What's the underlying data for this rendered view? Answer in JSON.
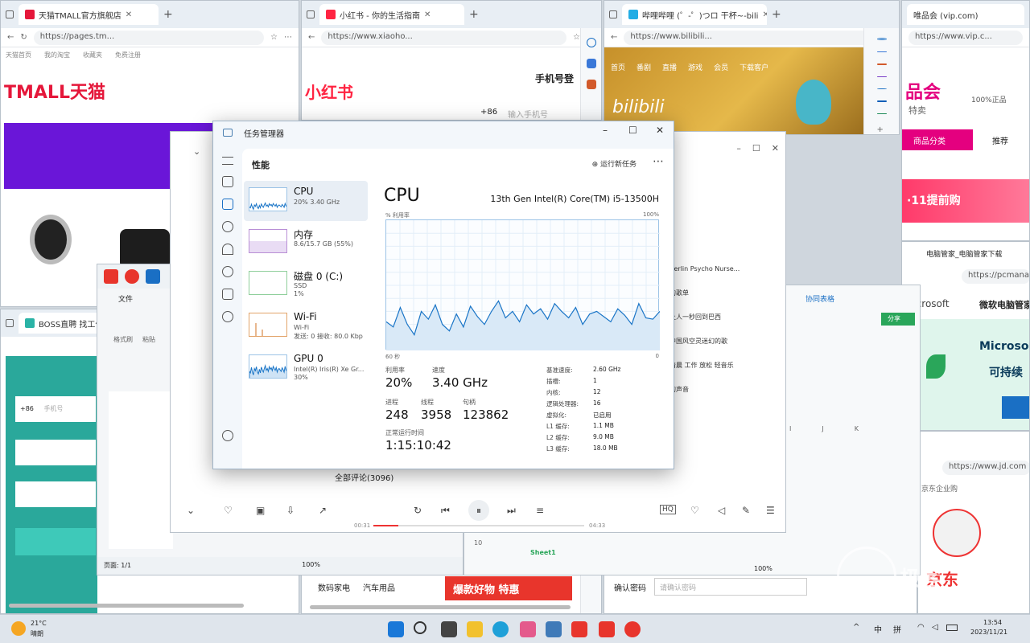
{
  "browsers": {
    "tmall": {
      "tab_title": "天猫TMALL官方旗舰店",
      "url": "https://pages.tm...",
      "logo": "TMALL天猫",
      "bookmarks": [
        "天猫首页",
        "我的淘宝",
        "收藏夹",
        "免费注册"
      ],
      "accent": "#e5173a"
    },
    "xiaohongshu": {
      "tab_title": "小红书 - 你的生活指南",
      "url": "https://www.xiaoho...",
      "logo": "小红书",
      "login_label": "手机号登",
      "phone_code": "+86",
      "phone_placeholder": "输入手机号",
      "accent": "#ff2442"
    },
    "bilibili": {
      "tab_title": "哔哩哔哩 (゜-゜)つロ 干杯~-bili",
      "url": "https://www.bilibili...",
      "logo": "bilibili",
      "nav": [
        "首页",
        "番剧",
        "直播",
        "游戏",
        "会员",
        "下载客户"
      ]
    },
    "vip": {
      "tab_title": "唯品会 (vip.com)",
      "url": "https://www.vip.c...",
      "logo": "品会",
      "slogan": "特卖",
      "badge": "100%正品",
      "category_btn": "商品分类",
      "recommend": "推荐",
      "banner": "·11提前购"
    },
    "pcmanager": {
      "tab_title": "电脑管家_电脑管家下载",
      "url": "https://pcmanag...",
      "brand": "Microsoft",
      "product": "微软电脑管家",
      "hero_title": "Microso",
      "hero_sub": "可持续"
    },
    "jd": {
      "url": "https://www.jd.com",
      "section": "京东企业购",
      "logo": "京东"
    },
    "boss": {
      "tab_title": "BOSS直聘 找工作",
      "phone_code": "+86",
      "phone_placeholder": "手机号"
    }
  },
  "task_manager": {
    "app_title": "任务管理器",
    "section": "性能",
    "run_new_task": "运行新任务",
    "items": [
      {
        "name": "CPU",
        "line1": "20% 3.40 GHz",
        "line2": ""
      },
      {
        "name": "内存",
        "line1": "8.6/15.7 GB (55%)",
        "line2": ""
      },
      {
        "name": "磁盘 0 (C:)",
        "line1": "SSD",
        "line2": "1%"
      },
      {
        "name": "Wi-Fi",
        "line1": "Wi-Fi",
        "line2": "发送: 0 接收: 80.0 Kbp"
      },
      {
        "name": "GPU 0",
        "line1": "Intel(R) Iris(R) Xe Gr...",
        "line2": "30%"
      }
    ],
    "cpu_title": "CPU",
    "cpu_model": "13th Gen Intel(R) Core(TM) i5-13500H",
    "graph_label_left": "% 利用率",
    "graph_label_right": "100%",
    "graph_time": "60 秒",
    "graph_zero": "0",
    "graph_utilization": [
      0.22,
      0.18,
      0.33,
      0.2,
      0.12,
      0.3,
      0.24,
      0.35,
      0.2,
      0.15,
      0.28,
      0.18,
      0.34,
      0.26,
      0.2,
      0.3,
      0.38,
      0.25,
      0.3,
      0.22,
      0.35,
      0.28,
      0.32,
      0.24,
      0.36,
      0.3,
      0.25,
      0.33,
      0.2,
      0.28,
      0.3,
      0.26,
      0.22,
      0.32,
      0.27,
      0.2,
      0.36,
      0.25,
      0.24,
      0.3
    ],
    "stats": {
      "util_label": "利用率",
      "util_value": "20%",
      "speed_label": "速度",
      "speed_value": "3.40 GHz",
      "proc_label": "进程",
      "proc_value": "248",
      "thread_label": "线程",
      "thread_value": "3958",
      "handle_label": "句柄",
      "handle_value": "123862",
      "uptime_label": "正常运行时间",
      "uptime_value": "1:15:10:42"
    },
    "specs": [
      [
        "基准速度:",
        "2.60 GHz"
      ],
      [
        "插槽:",
        "1"
      ],
      [
        "内核:",
        "12"
      ],
      [
        "逻辑处理器:",
        "16"
      ],
      [
        "虚拟化:",
        "已启用"
      ],
      [
        "L1 缓存:",
        "1.1 MB"
      ],
      [
        "L2 缓存:",
        "9.0 MB"
      ],
      [
        "L3 缓存:",
        "18.0 MB"
      ]
    ]
  },
  "media_player": {
    "comments": "全部评论(3096)",
    "time_start": "00:31",
    "time_end": "04:33",
    "progress": 0.12,
    "lines": [
      "Berlin Psycho Nurse...",
      "的歌单",
      "让人一秒回到巴西",
      "中国风空灵迷幻的歌",
      "清晨 工作 放松 轻音乐",
      "的声音"
    ]
  },
  "wps_doc": {
    "tab": "文件",
    "status": "页面: 1/1",
    "zoom": "100%",
    "toolbar": [
      "格式刷",
      "粘贴"
    ]
  },
  "sheet": {
    "title": "协同表格",
    "share": "分享",
    "sheet_tab": "Sheet1",
    "zoom": "100%",
    "cols": [
      "I",
      "J",
      "K"
    ],
    "row": "10"
  },
  "shopping_banner": {
    "text": "爆款好物 特惠",
    "categories": [
      "数码家电",
      "汽车用品"
    ]
  },
  "login_form": {
    "label": "确认密码",
    "placeholder": "请确认密码"
  },
  "taskbar": {
    "weather_temp": "21°C",
    "weather_desc": "晴朗",
    "time": "13:54",
    "date": "2023/11/21",
    "ime": "中",
    "ime2": "拼"
  },
  "watermark": "极客"
}
